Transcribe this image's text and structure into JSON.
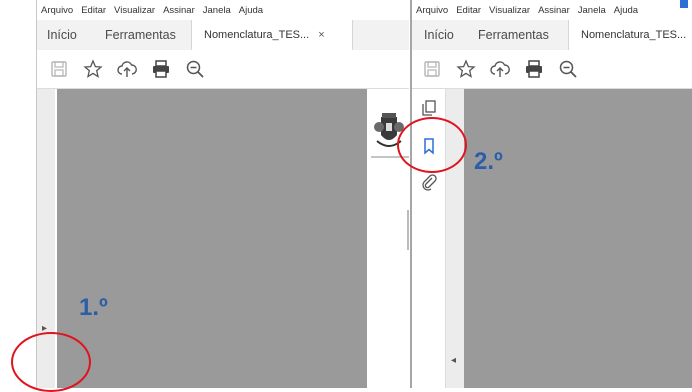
{
  "menu": [
    "Arquivo",
    "Editar",
    "Visualizar",
    "Assinar",
    "Janela",
    "Ajuda"
  ],
  "left_window": {
    "tabs": {
      "home": "Início",
      "tools": "Ferramentas",
      "document": "Nomenclatura_TES...",
      "close": "×"
    },
    "toolbar_icons": [
      "save-icon",
      "star-icon",
      "cloud-upload-icon",
      "print-icon",
      "zoom-out-icon"
    ],
    "step_label": "1.º",
    "nav_pane_arrow": "▸"
  },
  "right_window": {
    "tabs": {
      "home": "Início",
      "tools": "Ferramentas",
      "document": "Nomenclatura_TES..."
    },
    "toolbar_icons": [
      "save-icon",
      "star-icon",
      "cloud-upload-icon",
      "print-icon",
      "zoom-out-icon"
    ],
    "sidebar_icons": [
      "page-thumbnails-icon",
      "bookmark-icon",
      "attachment-icon"
    ],
    "step_label": "2.º",
    "collapse_arrow": "◂"
  },
  "colors": {
    "annotation_red": "#e0141e",
    "step_blue": "#2a5ea8",
    "page_gray": "#9a9a9a"
  }
}
